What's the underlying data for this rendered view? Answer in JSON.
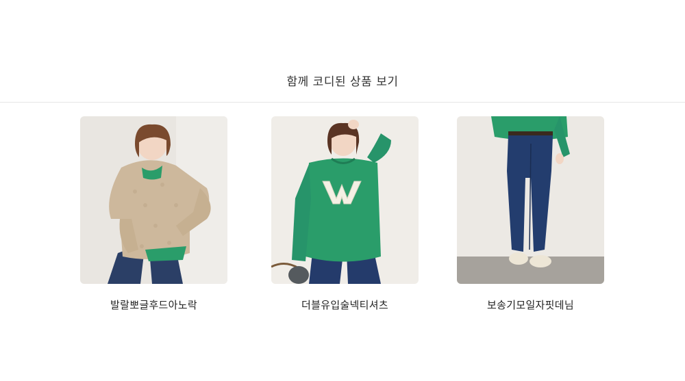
{
  "section": {
    "title": "함께 코디된 상품 보기"
  },
  "products": [
    {
      "name": "발랄뽀글후드아노락",
      "image": "model-beige-fleece-anorak"
    },
    {
      "name": "더블유입술넥티셔츠",
      "image": "model-green-w-sweatshirt"
    },
    {
      "name": "보송기모일자핏데님",
      "image": "model-straight-fit-denim"
    }
  ],
  "colors": {
    "title": "#333333",
    "divider": "#e6e6e6",
    "product_name": "#222222",
    "sweatshirt_green": "#2a9d6a",
    "denim_blue": "#233d6e",
    "fleece_beige": "#cdb89c"
  }
}
